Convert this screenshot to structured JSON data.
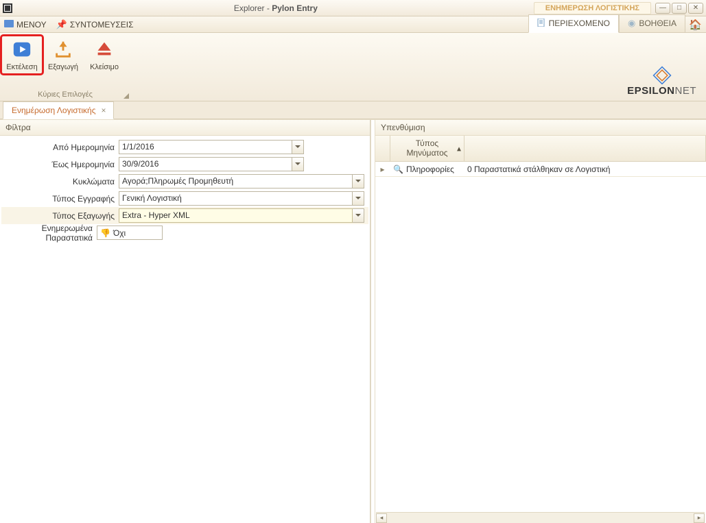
{
  "titlebar": {
    "title_prefix": "Explorer - ",
    "title_bold": "Pylon Entry",
    "active_context": "ΕΝΗΜΕΡΩΣΗ ΛΟΓΙΣΤΙΚΗΣ"
  },
  "menubar": {
    "menu": "ΜΕΝΟΥ",
    "shortcuts": "ΣΥΝΤΟΜΕΥΣΕΙΣ",
    "tab_content": "ΠΕΡΙΕΧΟΜΕΝΟ",
    "tab_help": "ΒΟΗΘΕΙΑ"
  },
  "ribbon": {
    "run": "Εκτέλεση",
    "export": "Εξαγωγή",
    "close": "Κλείσιμο",
    "group_caption": "Κύριες Επιλογές"
  },
  "brand": {
    "part1": "EPSILON",
    "part2": "NET"
  },
  "tab": {
    "label": "Ενημέρωση Λογιστικής"
  },
  "left": {
    "filters_header": "Φίλτρα",
    "from_date_label": "Από Ημερομηνία",
    "from_date_value": "1/1/2016",
    "to_date_label": "Έως Ημερομηνία",
    "to_date_value": "30/9/2016",
    "circuits_label": "Κυκλώματα",
    "circuits_value": "Αγορά;Πληρωμές Προμηθευτή",
    "doc_type_label": "Τύπος Εγγραφής",
    "doc_type_value": "Γενική Λογιστική",
    "export_type_label": "Τύπος Εξαγωγής",
    "export_type_value": "Extra - Hyper XML",
    "updated_docs_label": "Ενημερωμένα Παραστατικά",
    "updated_docs_value": "Όχι"
  },
  "right": {
    "reminder_header": "Υπενθύμιση",
    "col_msg_type_line1": "Τύπος",
    "col_msg_type_line2": "Μηνύματος",
    "row_info_label": "Πληροφορίες",
    "row_info_msg": "0 Παραστατικά στάλθηκαν σε Λογιστική"
  }
}
